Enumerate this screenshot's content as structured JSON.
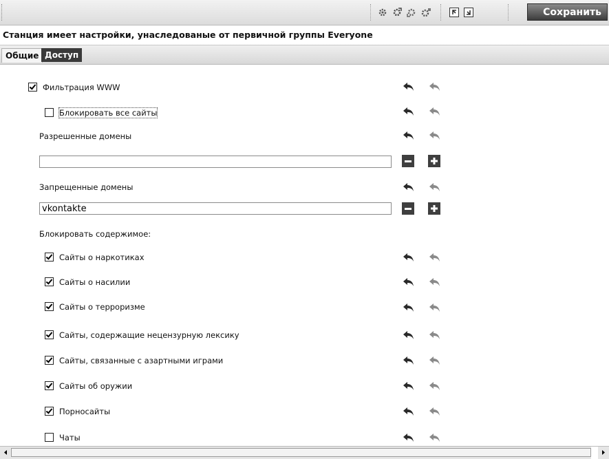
{
  "toolbar": {
    "icons": [
      "gear-refresh-icon",
      "gear-export-icon",
      "gear-import-icon",
      "gear-settings-icon",
      "import-icon",
      "export-icon"
    ],
    "save_label": "Сохранить"
  },
  "notice": "Станция имеет настройки, унаследованые от первичной группы Everyone",
  "tabs": {
    "general": "Общие",
    "access": "Доступ"
  },
  "form": {
    "www_filter": {
      "label": "Фильтрация WWW",
      "checked": true
    },
    "block_all": {
      "label": "Блокировать все сайты",
      "checked": false
    },
    "allowed_label": "Разрешенные домены",
    "allowed_value": "",
    "forbidden_label": "Запрещенные домены",
    "forbidden_value": "vkontakte",
    "block_content_label": "Блокировать содержимое:",
    "categories": [
      {
        "label": "Сайты о наркотиках",
        "checked": true
      },
      {
        "label": "Сайты о насилии",
        "checked": true
      },
      {
        "label": "Сайты о терроризме",
        "checked": true
      },
      {
        "label": "Сайты, содержащие нецензурную лексику",
        "checked": true
      },
      {
        "label": "Сайты, связанные с азартными играми",
        "checked": true
      },
      {
        "label": "Сайты об оружии",
        "checked": true
      },
      {
        "label": "Порносайты",
        "checked": true
      },
      {
        "label": "Чаты",
        "checked": false
      }
    ]
  }
}
